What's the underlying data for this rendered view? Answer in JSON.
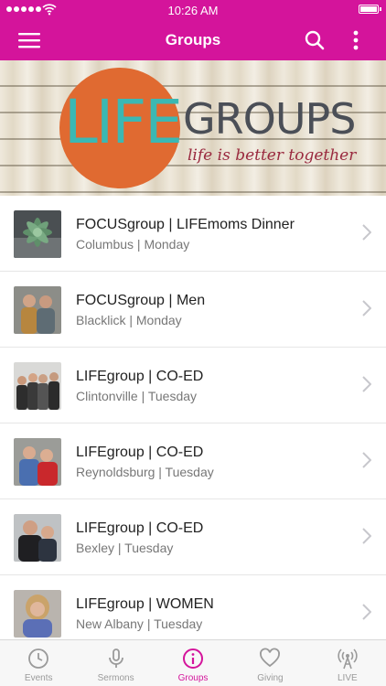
{
  "status_bar": {
    "time": "10:26 AM"
  },
  "header": {
    "title": "Groups",
    "menu_icon": "hamburger-icon",
    "search_icon": "search-icon",
    "more_icon": "more-vertical-icon"
  },
  "banner": {
    "logo_word_1": "LIFE",
    "logo_word_2": "GROUPS",
    "tagline": "life is better together"
  },
  "groups": [
    {
      "title": "FOCUSgroup | LIFEmoms Dinner",
      "subtitle": "Columbus | Monday"
    },
    {
      "title": "FOCUSgroup | Men",
      "subtitle": "Blacklick | Monday"
    },
    {
      "title": "LIFEgroup | CO-ED",
      "subtitle": "Clintonville | Tuesday"
    },
    {
      "title": "LIFEgroup | CO-ED",
      "subtitle": "Reynoldsburg | Tuesday"
    },
    {
      "title": "LIFEgroup | CO-ED",
      "subtitle": "Bexley | Tuesday"
    },
    {
      "title": "LIFEgroup | WOMEN",
      "subtitle": "New Albany | Tuesday"
    }
  ],
  "tabs": [
    {
      "label": "Events",
      "icon": "clock-icon",
      "active": false
    },
    {
      "label": "Sermons",
      "icon": "microphone-icon",
      "active": false
    },
    {
      "label": "Groups",
      "icon": "info-icon",
      "active": true
    },
    {
      "label": "Giving",
      "icon": "heart-icon",
      "active": false
    },
    {
      "label": "LIVE",
      "icon": "broadcast-icon",
      "active": false
    }
  ],
  "colors": {
    "brand": "#d4149b",
    "logo_orange": "#e06a31",
    "logo_teal": "#3bb8b3"
  }
}
